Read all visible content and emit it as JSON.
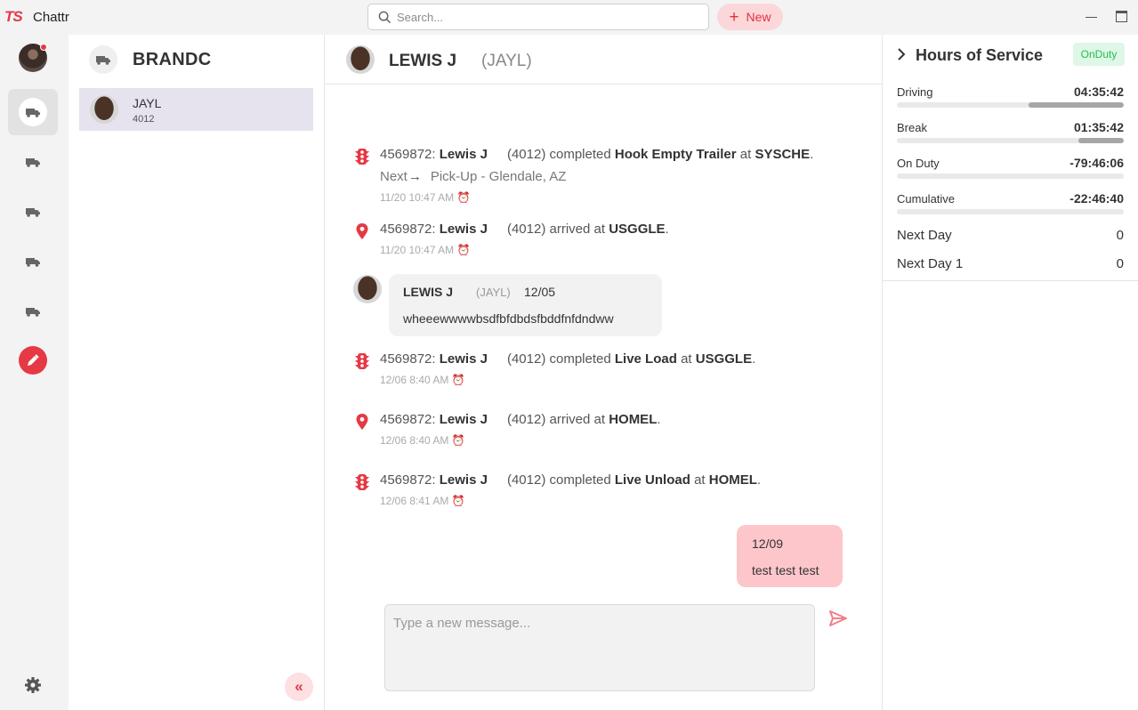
{
  "titlebar": {
    "logo": "TS",
    "app_name": "Chattr",
    "search_placeholder": "Search...",
    "new_label": "New"
  },
  "conversations": {
    "group_title": "BRANDC",
    "items": [
      {
        "name": "JAYL",
        "sub": "4012"
      }
    ]
  },
  "chat": {
    "header_name": "LEWIS J",
    "header_code": "(JAYL)",
    "messages": [
      {
        "type": "completed",
        "id": "4569872:",
        "driver": "Lewis J",
        "driver_code": "(4012)",
        "verb": "completed",
        "task": "Hook Empty Trailer",
        "at": "at",
        "location": "SYSCHE",
        "end": ".",
        "next_label": "Next",
        "next_value": "Pick-Up - Glendale, AZ",
        "time": "11/20 10:47 AM"
      },
      {
        "type": "arrived",
        "id": "4569872:",
        "driver": "Lewis J",
        "driver_code": "(4012)",
        "verb": "arrived at",
        "location": "USGGLE",
        "end": ".",
        "time": "11/20 10:47 AM"
      },
      {
        "type": "completed",
        "id": "4569872:",
        "driver": "Lewis J",
        "driver_code": "(4012)",
        "verb": "completed",
        "task": "Live Load",
        "at": "at",
        "location": "USGGLE",
        "end": ".",
        "time": "12/06 8:40 AM"
      },
      {
        "type": "arrived",
        "id": "4569872:",
        "driver": "Lewis J",
        "driver_code": "(4012)",
        "verb": "arrived at",
        "location": "HOMEL",
        "end": ".",
        "time": "12/06 8:40 AM"
      },
      {
        "type": "completed",
        "id": "4569872:",
        "driver": "Lewis J",
        "driver_code": "(4012)",
        "verb": "completed",
        "task": "Live Unload",
        "at": "at",
        "location": "HOMEL",
        "end": ".",
        "time": "12/06 8:41 AM"
      }
    ],
    "incoming": {
      "name": "LEWIS J",
      "code": "(JAYL)",
      "date": "12/05",
      "text": "wheeewwwwbsdfbfdbdsfbddfnfdndww"
    },
    "outgoing": {
      "date": "12/09",
      "text": "test test test"
    },
    "composer_placeholder": "Type a new message..."
  },
  "hos": {
    "title": "Hours of Service",
    "status": "OnDuty",
    "rows": [
      {
        "label": "Driving",
        "value": "04:35:42",
        "fraction": 0.42
      },
      {
        "label": "Break",
        "value": "01:35:42",
        "fraction": 0.2
      },
      {
        "label": "On Duty",
        "value": "-79:46:06",
        "fraction": 0
      },
      {
        "label": "Cumulative",
        "value": "-22:46:40",
        "fraction": 0
      }
    ],
    "next_day": [
      {
        "label": "Next Day",
        "value": "0"
      },
      {
        "label": "Next Day 1",
        "value": "0"
      }
    ]
  },
  "colors": {
    "accent": "#e53945",
    "accent_light": "#fcd7da",
    "outgoing_bubble": "#fcc6ca",
    "status_green": "#1fbf56"
  },
  "icons": {
    "rail": [
      "avatar",
      "truck-icon",
      "truck-icon",
      "truck-icon",
      "truck-icon",
      "truck-icon",
      "pencil-icon",
      "gear-icon"
    ]
  }
}
